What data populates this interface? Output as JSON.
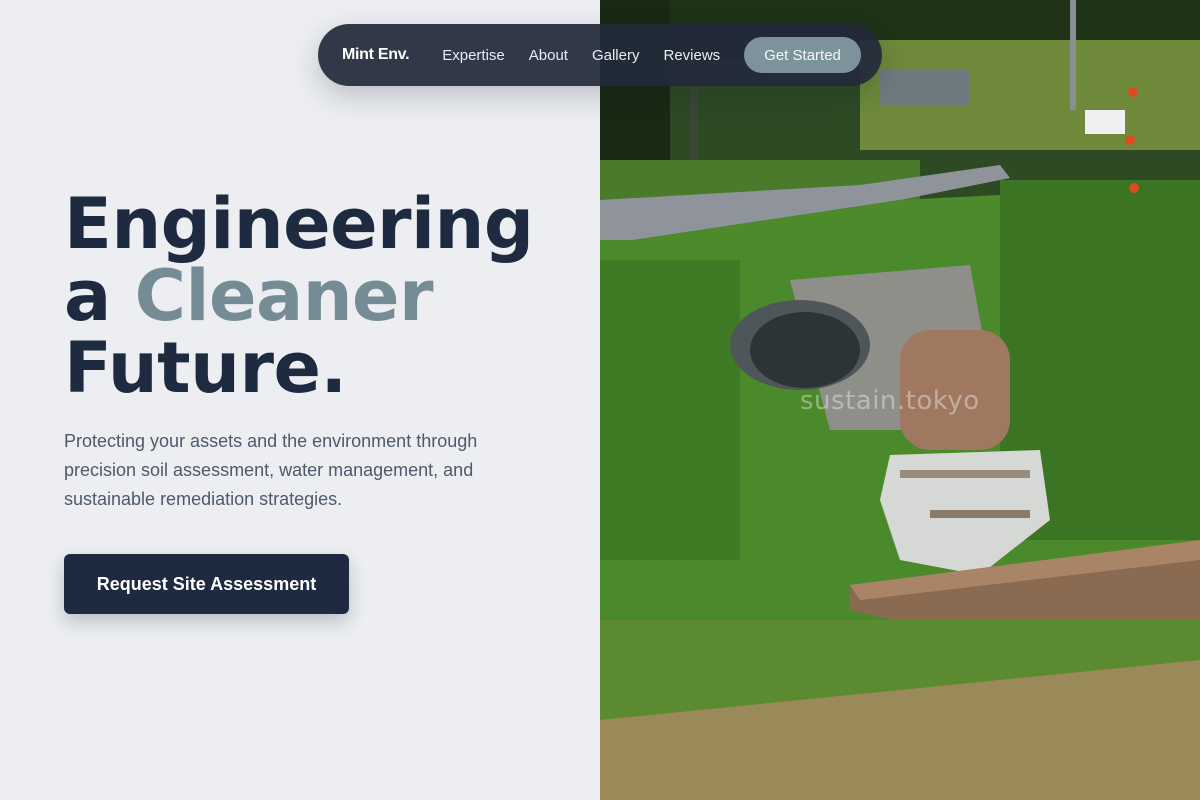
{
  "nav": {
    "brand": "Mint Env.",
    "links": [
      "Expertise",
      "About",
      "Gallery",
      "Reviews"
    ],
    "cta": "Get Started"
  },
  "hero": {
    "headline_line1": "Engineering",
    "headline_line2_a": "a ",
    "headline_line2_accent": "Cleaner",
    "headline_line3": "Future.",
    "subtitle": "Protecting your assets and the environment through precision soil assessment, water management, and sustainable remediation strategies.",
    "cta": "Request Site Assessment"
  },
  "image": {
    "watermark": "sustain.tokyo",
    "subject": "culvert-pipe-with-creek-photo"
  },
  "colors": {
    "navy": "#1e2a40",
    "accent": "#758c96",
    "background": "#eceef1",
    "nav_cta": "#7d939c"
  }
}
